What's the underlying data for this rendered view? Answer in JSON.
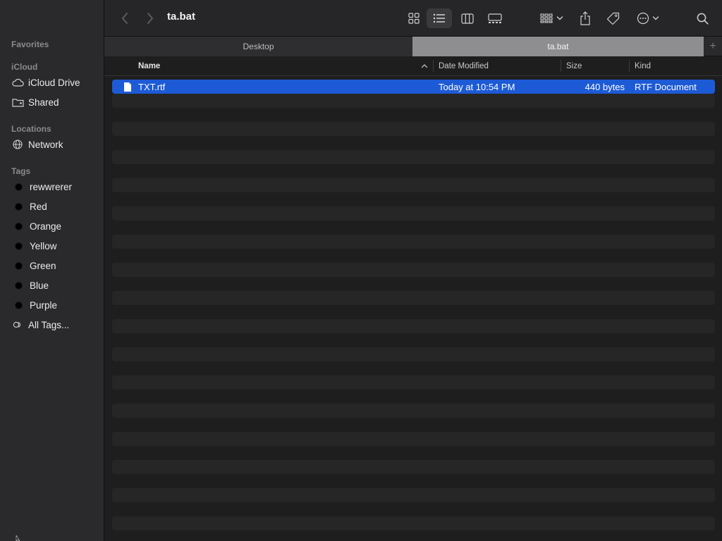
{
  "sidebar": {
    "favorites_label": "Favorites",
    "icloud_label": "iCloud",
    "icloud_items": [
      {
        "label": "iCloud Drive",
        "icon": "cloud-icon"
      },
      {
        "label": "Shared",
        "icon": "shared-folder-icon"
      }
    ],
    "locations_label": "Locations",
    "location_items": [
      {
        "label": "Network",
        "icon": "globe-icon"
      }
    ],
    "tags_label": "Tags",
    "tags": [
      {
        "label": "rewwrerer",
        "color": "#000000"
      },
      {
        "label": "Red",
        "color": "#000000"
      },
      {
        "label": "Orange",
        "color": "#000000"
      },
      {
        "label": "Yellow",
        "color": "#000000"
      },
      {
        "label": "Green",
        "color": "#000000"
      },
      {
        "label": "Blue",
        "color": "#000000"
      },
      {
        "label": "Purple",
        "color": "#000000"
      }
    ],
    "all_tags_label": "All Tags..."
  },
  "toolbar": {
    "title": "ta.bat",
    "active_view": "list"
  },
  "tabs": [
    {
      "label": "Desktop",
      "active": false
    },
    {
      "label": "ta.bat",
      "active": true
    }
  ],
  "columns": {
    "name": "Name",
    "date": "Date Modified",
    "size": "Size",
    "kind": "Kind",
    "sort_column": "name"
  },
  "files": [
    {
      "name": "TXT.rtf",
      "date": "Today at 10:54 PM",
      "size": "440 bytes",
      "kind": "RTF Document",
      "selected": true,
      "icon": "document-icon"
    }
  ],
  "colors": {
    "selection": "#1d5bd6",
    "sidebar_bg": "#2a2a2c",
    "active_tab": "#8e8e90"
  }
}
